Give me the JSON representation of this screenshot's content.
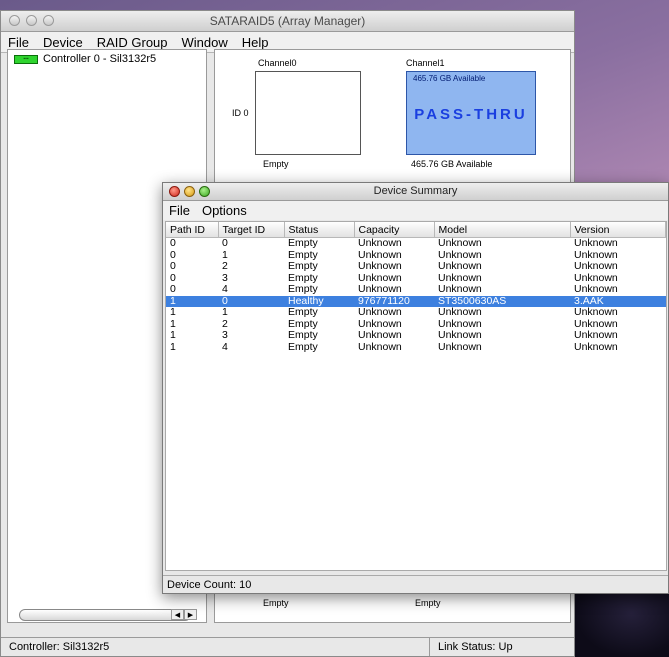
{
  "main_window": {
    "title": "SATARAID5 (Array Manager)",
    "menu": [
      "File",
      "Device",
      "RAID Group",
      "Window",
      "Help"
    ],
    "tree": {
      "controller_label": "Controller 0 - Sil3132r5",
      "icon": "controller-chip-icon"
    },
    "channels": {
      "channel0_label": "Channel0",
      "channel1_label": "Channel1",
      "id_label": "ID 0",
      "channel0_status": "Empty",
      "channel1_available_top": "465.76 GB Available",
      "channel1_mode": "PASS-THRU",
      "channel1_available_bottom": "465.76 GB Available",
      "bottom_empty_0": "Empty",
      "bottom_empty_1": "Empty"
    },
    "status_left": "Controller: Sil3132r5",
    "status_right": "Link Status: Up"
  },
  "summary_window": {
    "title": "Device Summary",
    "menu": [
      "File",
      "Options"
    ],
    "columns": [
      "Path ID",
      "Target ID",
      "Status",
      "Capacity",
      "Model",
      "Version"
    ],
    "rows": [
      [
        "0",
        "0",
        "Empty",
        "Unknown",
        "Unknown",
        "Unknown"
      ],
      [
        "0",
        "1",
        "Empty",
        "Unknown",
        "Unknown",
        "Unknown"
      ],
      [
        "0",
        "2",
        "Empty",
        "Unknown",
        "Unknown",
        "Unknown"
      ],
      [
        "0",
        "3",
        "Empty",
        "Unknown",
        "Unknown",
        "Unknown"
      ],
      [
        "0",
        "4",
        "Empty",
        "Unknown",
        "Unknown",
        "Unknown"
      ],
      [
        "1",
        "0",
        "Healthy",
        "976771120",
        "ST3500630AS",
        "3.AAK"
      ],
      [
        "1",
        "1",
        "Empty",
        "Unknown",
        "Unknown",
        "Unknown"
      ],
      [
        "1",
        "2",
        "Empty",
        "Unknown",
        "Unknown",
        "Unknown"
      ],
      [
        "1",
        "3",
        "Empty",
        "Unknown",
        "Unknown",
        "Unknown"
      ],
      [
        "1",
        "4",
        "Empty",
        "Unknown",
        "Unknown",
        "Unknown"
      ]
    ],
    "selected_row": 5,
    "device_count": "Device Count: 10"
  },
  "colors": {
    "selection": "#3d80df",
    "pass_thru_fill": "#8fb6f0",
    "pass_thru_text": "#1a3fe0",
    "controller_icon": "#2fd42f"
  }
}
